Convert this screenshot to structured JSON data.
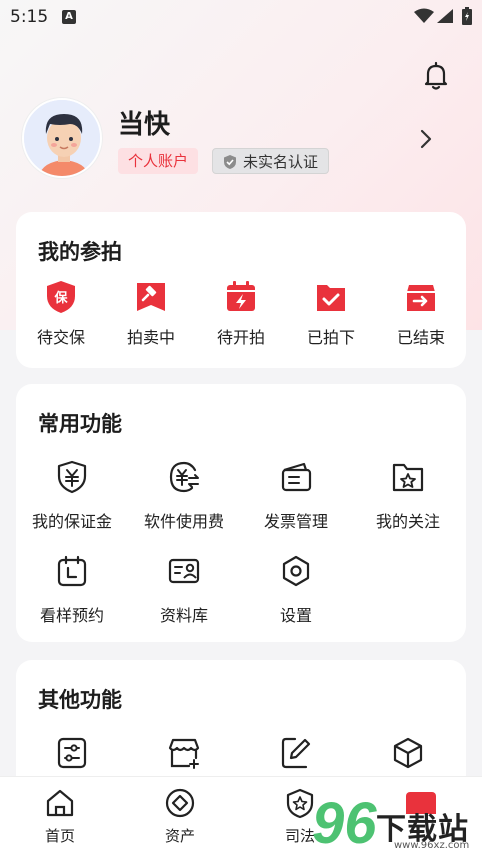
{
  "status": {
    "time": "5:15",
    "a_label": "A"
  },
  "profile": {
    "name": "当快",
    "account_type": "个人账户",
    "verify_status": "未实名认证"
  },
  "participation": {
    "title": "我的参拍",
    "items": [
      {
        "label": "待交保",
        "icon": "shield-bao-icon",
        "glyph": "保"
      },
      {
        "label": "拍卖中",
        "icon": "gavel-icon"
      },
      {
        "label": "待开拍",
        "icon": "calendar-lightning-icon"
      },
      {
        "label": "已拍下",
        "icon": "folder-check-icon"
      },
      {
        "label": "已结束",
        "icon": "box-arrow-icon"
      }
    ]
  },
  "common": {
    "title": "常用功能",
    "items": [
      {
        "label": "我的保证金",
        "icon": "shield-yen-icon"
      },
      {
        "label": "软件使用费",
        "icon": "yen-exchange-icon"
      },
      {
        "label": "发票管理",
        "icon": "wallet-invoice-icon"
      },
      {
        "label": "我的关注",
        "icon": "folder-star-icon"
      },
      {
        "label": "看样预约",
        "icon": "calendar-clock-icon"
      },
      {
        "label": "资料库",
        "icon": "id-card-icon"
      },
      {
        "label": "设置",
        "icon": "gear-icon"
      }
    ]
  },
  "other": {
    "title": "其他功能",
    "items": [
      {
        "icon": "sliders-icon"
      },
      {
        "icon": "shop-add-icon"
      },
      {
        "icon": "edit-icon"
      },
      {
        "icon": "cube-icon"
      }
    ]
  },
  "tabbar": {
    "items": [
      {
        "label": "首页",
        "icon": "home-icon"
      },
      {
        "label": "资产",
        "icon": "asset-icon"
      },
      {
        "label": "司法",
        "icon": "judicial-icon"
      }
    ]
  },
  "watermark": {
    "big": "96",
    "text": "下载站",
    "url": "www.96xz.com"
  },
  "colors": {
    "accent": "#e9323c",
    "badge_bg": "#fde0e3",
    "icon_dark": "#222222"
  }
}
